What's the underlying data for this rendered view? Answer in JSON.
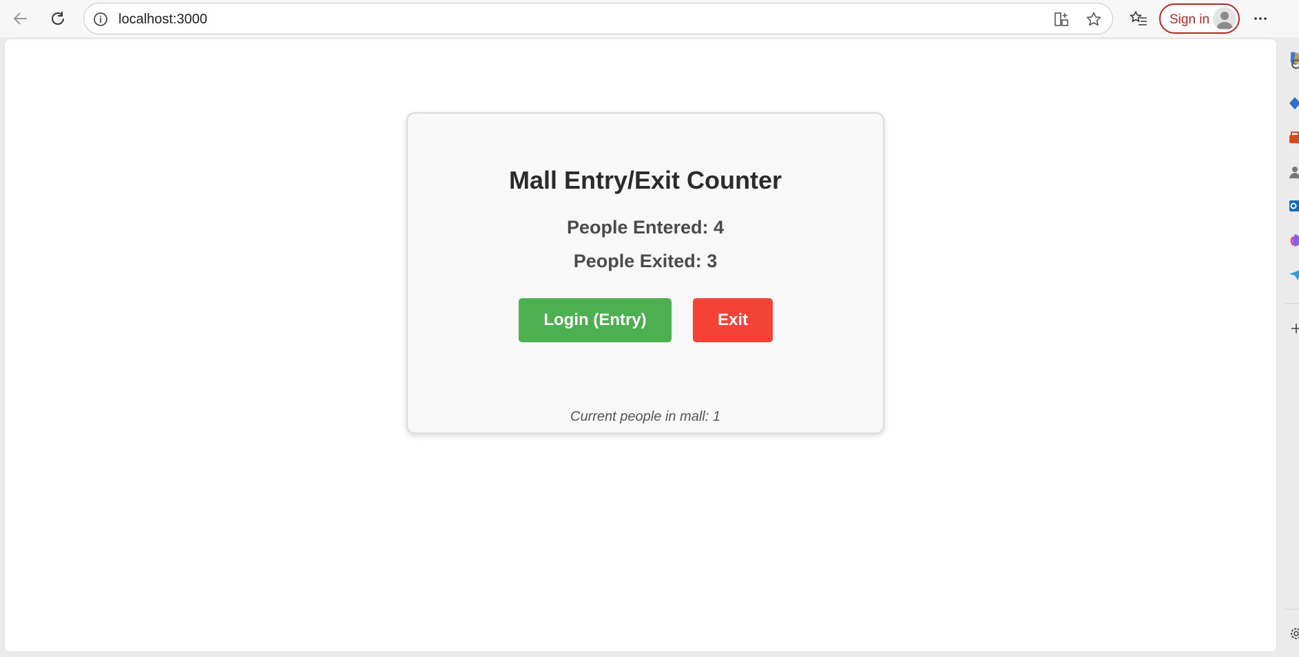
{
  "browser": {
    "url": "localhost:3000",
    "sign_in_label": "Sign in",
    "icons": [
      "back-icon",
      "refresh-icon",
      "info-icon",
      "split-screen-icon",
      "favorite-star-icon",
      "favorites-list-icon",
      "avatar-icon",
      "more-options-icon"
    ]
  },
  "app": {
    "title": "Mall Entry/Exit Counter",
    "entered_label": "People Entered: 4",
    "exited_label": "People Exited: 3",
    "entry_button": "Login (Entry)",
    "exit_button": "Exit",
    "current_label": "Current people in mall: 1"
  },
  "colors": {
    "entry_button": "#4caf50",
    "exit_button": "#f44336",
    "sign_in_accent": "#b3261e"
  }
}
